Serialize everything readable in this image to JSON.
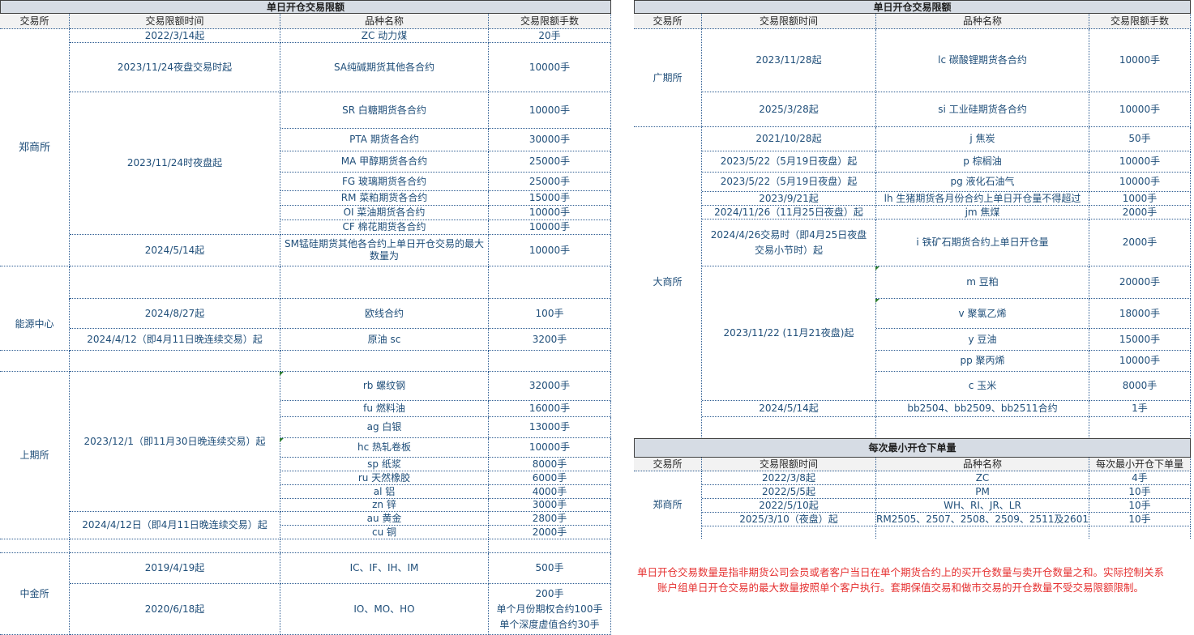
{
  "left_table": {
    "title": "单日开仓交易限额",
    "headers": [
      "交易所",
      "交易限额时间",
      "品种名称",
      "交易限额手数"
    ],
    "exchanges": [
      "郑商所",
      "能源中心",
      "上期所",
      "中金所"
    ],
    "zce_times": [
      "2022/3/14起",
      "2023/11/24夜盘交易时起",
      "2023/11/24时夜盘起",
      "2024/5/14起"
    ],
    "zce_products": [
      "ZC 动力煤",
      "SA纯碱期货其他各合约",
      "SR 白糖期货各合约",
      "PTA 期货各合约",
      "MA 甲醇期货各合约",
      "FG 玻璃期货各合约",
      "RM 菜粕期货各合约",
      "OI 菜油期货各合约",
      "CF 棉花期货各合约",
      "SM锰硅期货其他各合约上单日开仓交易的最大数量为"
    ],
    "zce_limits": [
      "20手",
      "10000手",
      "10000手",
      "30000手",
      "25000手",
      "25000手",
      "15000手",
      "10000手",
      "10000手",
      "10000手"
    ],
    "ine_times": [
      "2024/8/27起",
      "2024/4/12（即4月11日晚连续交易）起"
    ],
    "ine_products": [
      "欧线合约",
      "原油 sc"
    ],
    "ine_limits": [
      "100手",
      "3200手"
    ],
    "shfe_times": [
      "2023/12/1（即11月30日晚连续交易）起",
      "2024/4/12日（即4月11日晚连续交易）起"
    ],
    "shfe_products": [
      "rb 螺纹钢",
      "fu 燃料油",
      "ag 白银",
      "hc 热轧卷板",
      "sp 纸浆",
      "ru 天然橡胶",
      "al  铝",
      "zn 锌",
      "au 黄金",
      "cu 铜"
    ],
    "shfe_limits": [
      "32000手",
      "16000手",
      "13000手",
      "10000手",
      "8000手",
      "6000手",
      "4000手",
      "3000手",
      "2800手",
      "2000手"
    ],
    "cffex_times": [
      "2019/4/19起",
      "2020/6/18起"
    ],
    "cffex_products": [
      "IC、IF、IH、IM",
      "IO、MO、HO"
    ],
    "cffex_limits": [
      "500手",
      "200手",
      "单个月份期权合约100手",
      "单个深度虚值合约30手"
    ]
  },
  "right_table": {
    "title": "单日开仓交易限额",
    "headers": [
      "交易所",
      "交易限额时间",
      "品种名称",
      "交易限额手数"
    ],
    "exchanges": [
      "广期所",
      "大商所"
    ],
    "gfex_times": [
      "2023/11/28起",
      "2025/3/28起"
    ],
    "gfex_products": [
      "lc 碳酸锂期货各合约",
      "si 工业硅期货各合约"
    ],
    "gfex_limits": [
      "10000手",
      "10000手"
    ],
    "dce_times": [
      "2021/10/28起",
      "2023/5/22（5月19日夜盘）起",
      "2023/5/22（5月19日夜盘）起",
      "2023/9/21起",
      "2024/11/26（11月25日夜盘）起",
      "2024/4/26交易时（即4月25日夜盘交易小节时）起",
      "2023/11/22 (11月21夜盘)起",
      "2024/5/14起"
    ],
    "dce_products": [
      "j 焦炭",
      "p 棕榈油",
      "pg 液化石油气",
      "lh 生猪期货各月份合约上单日开仓量不得超过",
      "jm 焦煤",
      "i 铁矿石期货合约上单日开仓量",
      "m 豆粕",
      "v 聚氯乙烯",
      "y 豆油",
      "pp 聚丙烯",
      "c 玉米",
      "bb2504、bb2509、bb2511合约"
    ],
    "dce_limits": [
      "50手",
      "10000手",
      "10000手",
      "1000手",
      "2000手",
      "2000手",
      "20000手",
      "18000手",
      "15000手",
      "10000手",
      "8000手",
      "1手"
    ]
  },
  "min_table": {
    "title": "每次最小开仓下单量",
    "headers": [
      "交易所",
      "交易限额时间",
      "品种名称",
      "每次最小开仓下单量"
    ],
    "exchange": "郑商所",
    "times": [
      "2022/3/8起",
      "2022/5/5起",
      "2022/5/10起",
      "2025/3/10（夜盘）起"
    ],
    "products": [
      "ZC",
      "PM",
      "WH、RI、JR、LR",
      "RM2505、2507、2508、2509、2511及2601"
    ],
    "limits": [
      "4手",
      "10手",
      "10手",
      "10手"
    ]
  },
  "note": "单日开仓交易数量是指非期货公司会员或者客户当日在单个期货合约上的买开仓数量与卖开仓数量之和。实际控制关系账户组单日开仓交易的最大数量按照单个客户执行。套期保值交易和做市交易的开仓数量不受交易限额限制。",
  "colors": {
    "text": "#1f4e79",
    "header_fill": "#d6dce4",
    "note": "#e53030"
  }
}
